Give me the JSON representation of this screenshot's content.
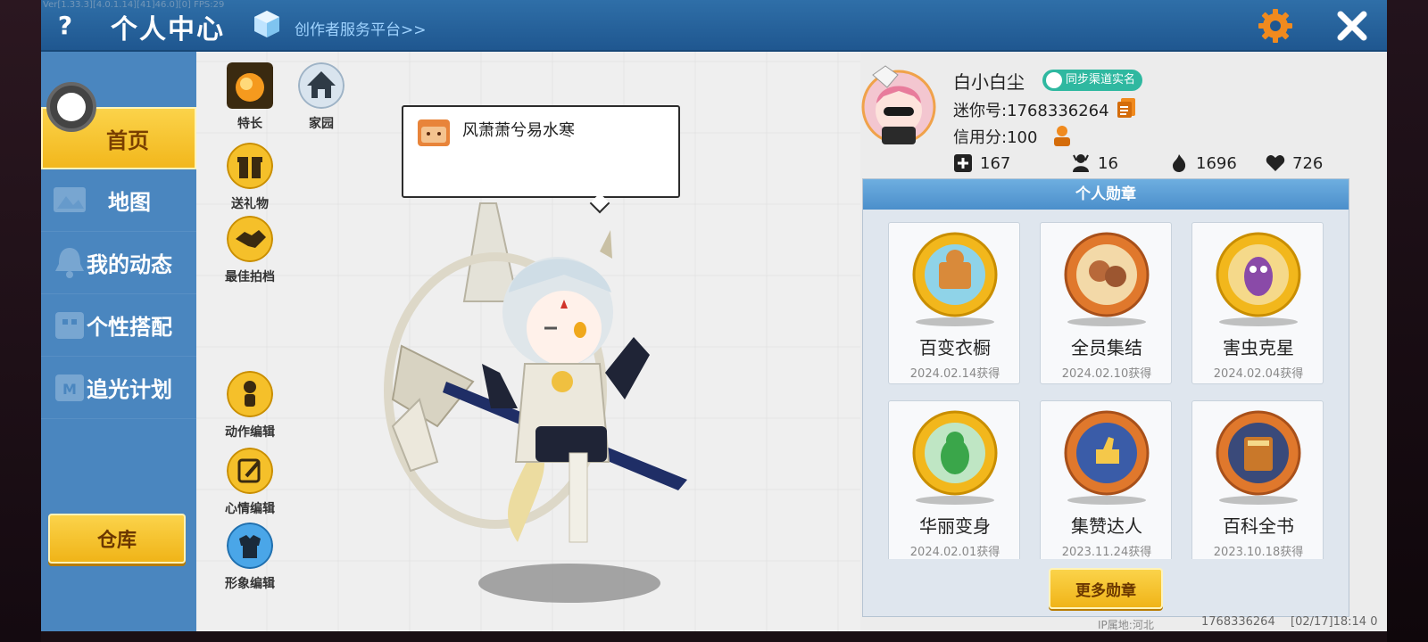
{
  "debug": "Ver[1.33.3][4.0.1.14][41]46.0][0] FPS:29",
  "header": {
    "help_label": "?",
    "title": "个人中心",
    "creator_link": "创作者服务平台>>",
    "close_label": "✕"
  },
  "sidebar": {
    "items": [
      {
        "label": "首页",
        "icon": "home-icon"
      },
      {
        "label": "地图",
        "icon": "map-icon"
      },
      {
        "label": "我的动态",
        "icon": "bell-icon"
      },
      {
        "label": "个性搭配",
        "icon": "outfit-icon"
      },
      {
        "label": "追光计划",
        "icon": "spotlight-icon"
      }
    ],
    "warehouse_label": "仓库"
  },
  "actions": {
    "specialty": "特长",
    "home": "家园",
    "gift": "送礼物",
    "partner": "最佳拍档",
    "motion_edit": "动作编辑",
    "mood_edit": "心情编辑",
    "look_edit": "形象编辑"
  },
  "speech": {
    "text": "风萧萧兮易水寒"
  },
  "profile": {
    "name": "白小白尘",
    "realname_badge": "同步渠道实名",
    "mini_id": "迷你号:1768336264",
    "credit": "信用分:100",
    "stats": {
      "friends": "167",
      "fans": "16",
      "popularity": "1696",
      "likes": "726"
    }
  },
  "badges": {
    "title": "个人勋章",
    "items": [
      {
        "name": "百变衣橱",
        "date": "2024.02.14获得"
      },
      {
        "name": "全员集结",
        "date": "2024.02.10获得"
      },
      {
        "name": "害虫克星",
        "date": "2024.02.04获得"
      },
      {
        "name": "华丽变身",
        "date": "2024.02.01获得"
      },
      {
        "name": "集赞达人",
        "date": "2023.11.24获得"
      },
      {
        "name": "百科全书",
        "date": "2023.10.18获得"
      }
    ],
    "more_label": "更多勋章"
  },
  "footer": {
    "ip": "IP属地:河北",
    "id": "1768336264",
    "time": "[02/17]18:14 0"
  },
  "colors": {
    "header_blue": "#2f6fa8",
    "sidebar_blue": "#4a86bf",
    "accent_yellow": "#f5c02a",
    "gear_orange": "#f08a1e",
    "badge_green": "#2fb8a0"
  }
}
